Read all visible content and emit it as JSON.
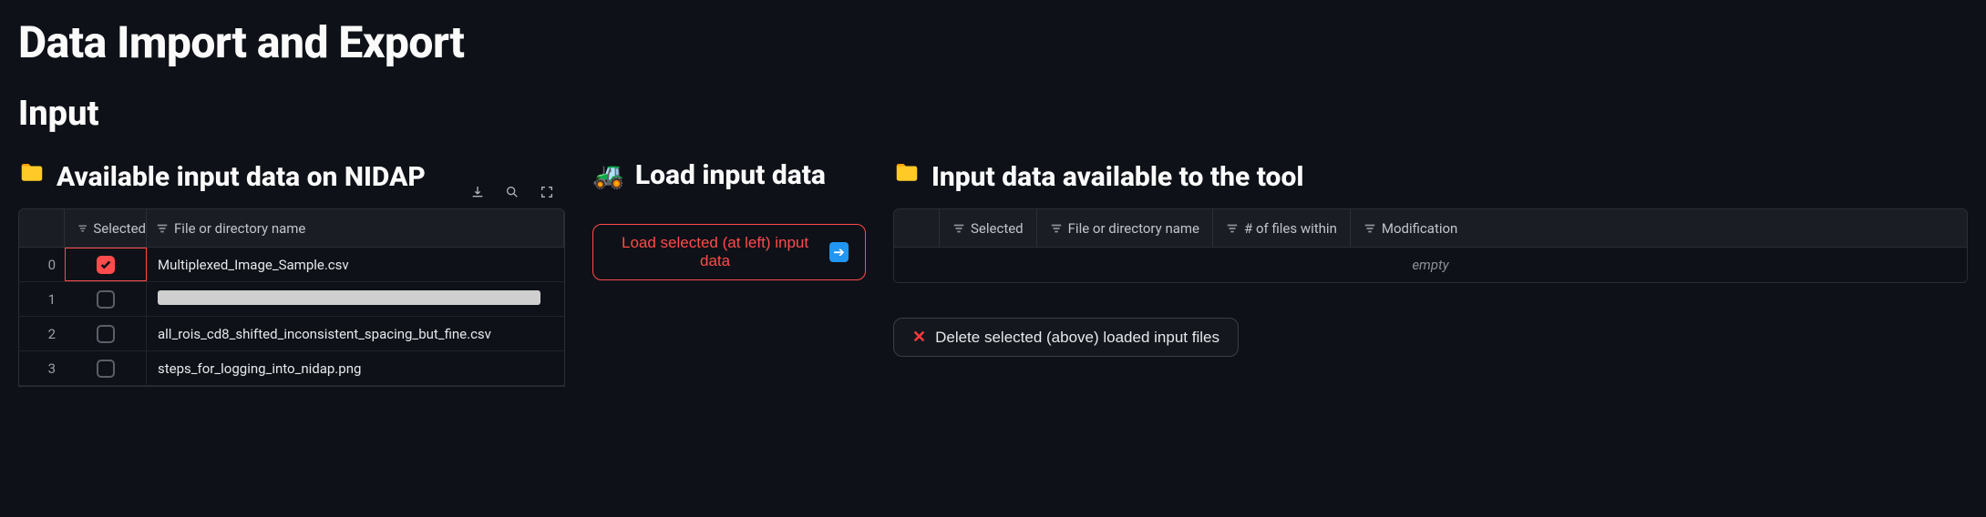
{
  "page_title": "Data Import and Export",
  "section_title": "Input",
  "panels": {
    "available": {
      "title": "Available input data on NIDAP"
    },
    "load": {
      "title": "Load input data",
      "button_label": "Load selected (at left) input data"
    },
    "loaded": {
      "title": "Input data available to the tool",
      "empty_text": "empty",
      "delete_label": "Delete selected (above) loaded input files"
    }
  },
  "columns": {
    "selected": "Selected",
    "name": "File or directory name",
    "count": "# of files within",
    "mtime": "Modification"
  },
  "available_rows": [
    {
      "idx": "0",
      "selected": true,
      "name": "Multiplexed_Image_Sample.csv",
      "redacted": false
    },
    {
      "idx": "1",
      "selected": false,
      "name": "",
      "redacted": true
    },
    {
      "idx": "2",
      "selected": false,
      "name": "all_rois_cd8_shifted_inconsistent_spacing_but_fine.csv",
      "redacted": false
    },
    {
      "idx": "3",
      "selected": false,
      "name": "steps_for_logging_into_nidap.png",
      "redacted": false
    }
  ]
}
